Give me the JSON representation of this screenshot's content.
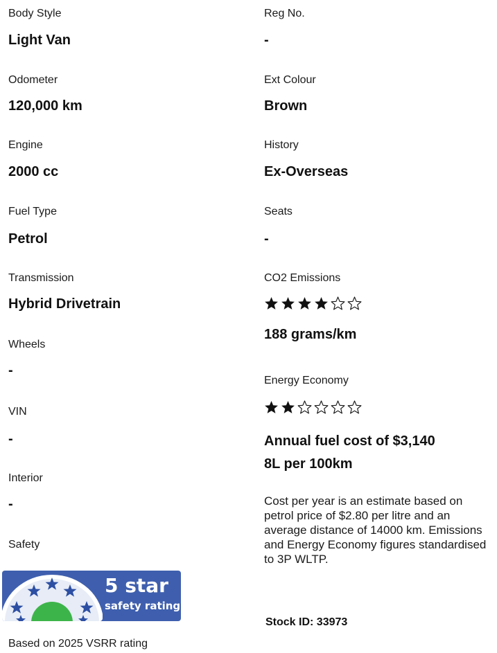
{
  "left": {
    "body_style": {
      "label": "Body Style",
      "value": "Light Van"
    },
    "odometer": {
      "label": "Odometer",
      "value": "120,000 km"
    },
    "engine": {
      "label": "Engine",
      "value": "2000 cc"
    },
    "fuel_type": {
      "label": "Fuel Type",
      "value": "Petrol"
    },
    "transmission": {
      "label": "Transmission",
      "value": "Hybrid Drivetrain"
    },
    "wheels": {
      "label": "Wheels",
      "value": "-"
    },
    "vin": {
      "label": "VIN",
      "value": "-"
    },
    "interior": {
      "label": "Interior",
      "value": "-"
    },
    "safety": {
      "label": "Safety",
      "badge_line1": "5 star",
      "badge_line2": "safety rating",
      "badge_rating": 5,
      "badge_color": "#3f5fae",
      "caption": "Based on 2025 VSRR rating"
    }
  },
  "right": {
    "reg_no": {
      "label": "Reg No.",
      "value": "-"
    },
    "ext_colour": {
      "label": "Ext Colour",
      "value": "Brown"
    },
    "history": {
      "label": "History",
      "value": "Ex-Overseas"
    },
    "seats": {
      "label": "Seats",
      "value": "-"
    },
    "co2": {
      "label": "CO2 Emissions",
      "rating": 4,
      "max_rating": 6,
      "value": "188 grams/km"
    },
    "energy": {
      "label": "Energy Economy",
      "rating": 2,
      "max_rating": 6,
      "annual_cost": "Annual fuel cost of $3,140",
      "consumption": "8L per 100km"
    },
    "note": "Cost per year is an estimate based on petrol price of  $2.80 per litre and an average distance of 14000 km. Emissions and Energy Economy figures standardised to 3P WLTP.",
    "stock_id": "Stock ID: 33973"
  },
  "icons": {
    "filled_star": "filled-star-icon",
    "empty_star": "empty-star-icon"
  }
}
